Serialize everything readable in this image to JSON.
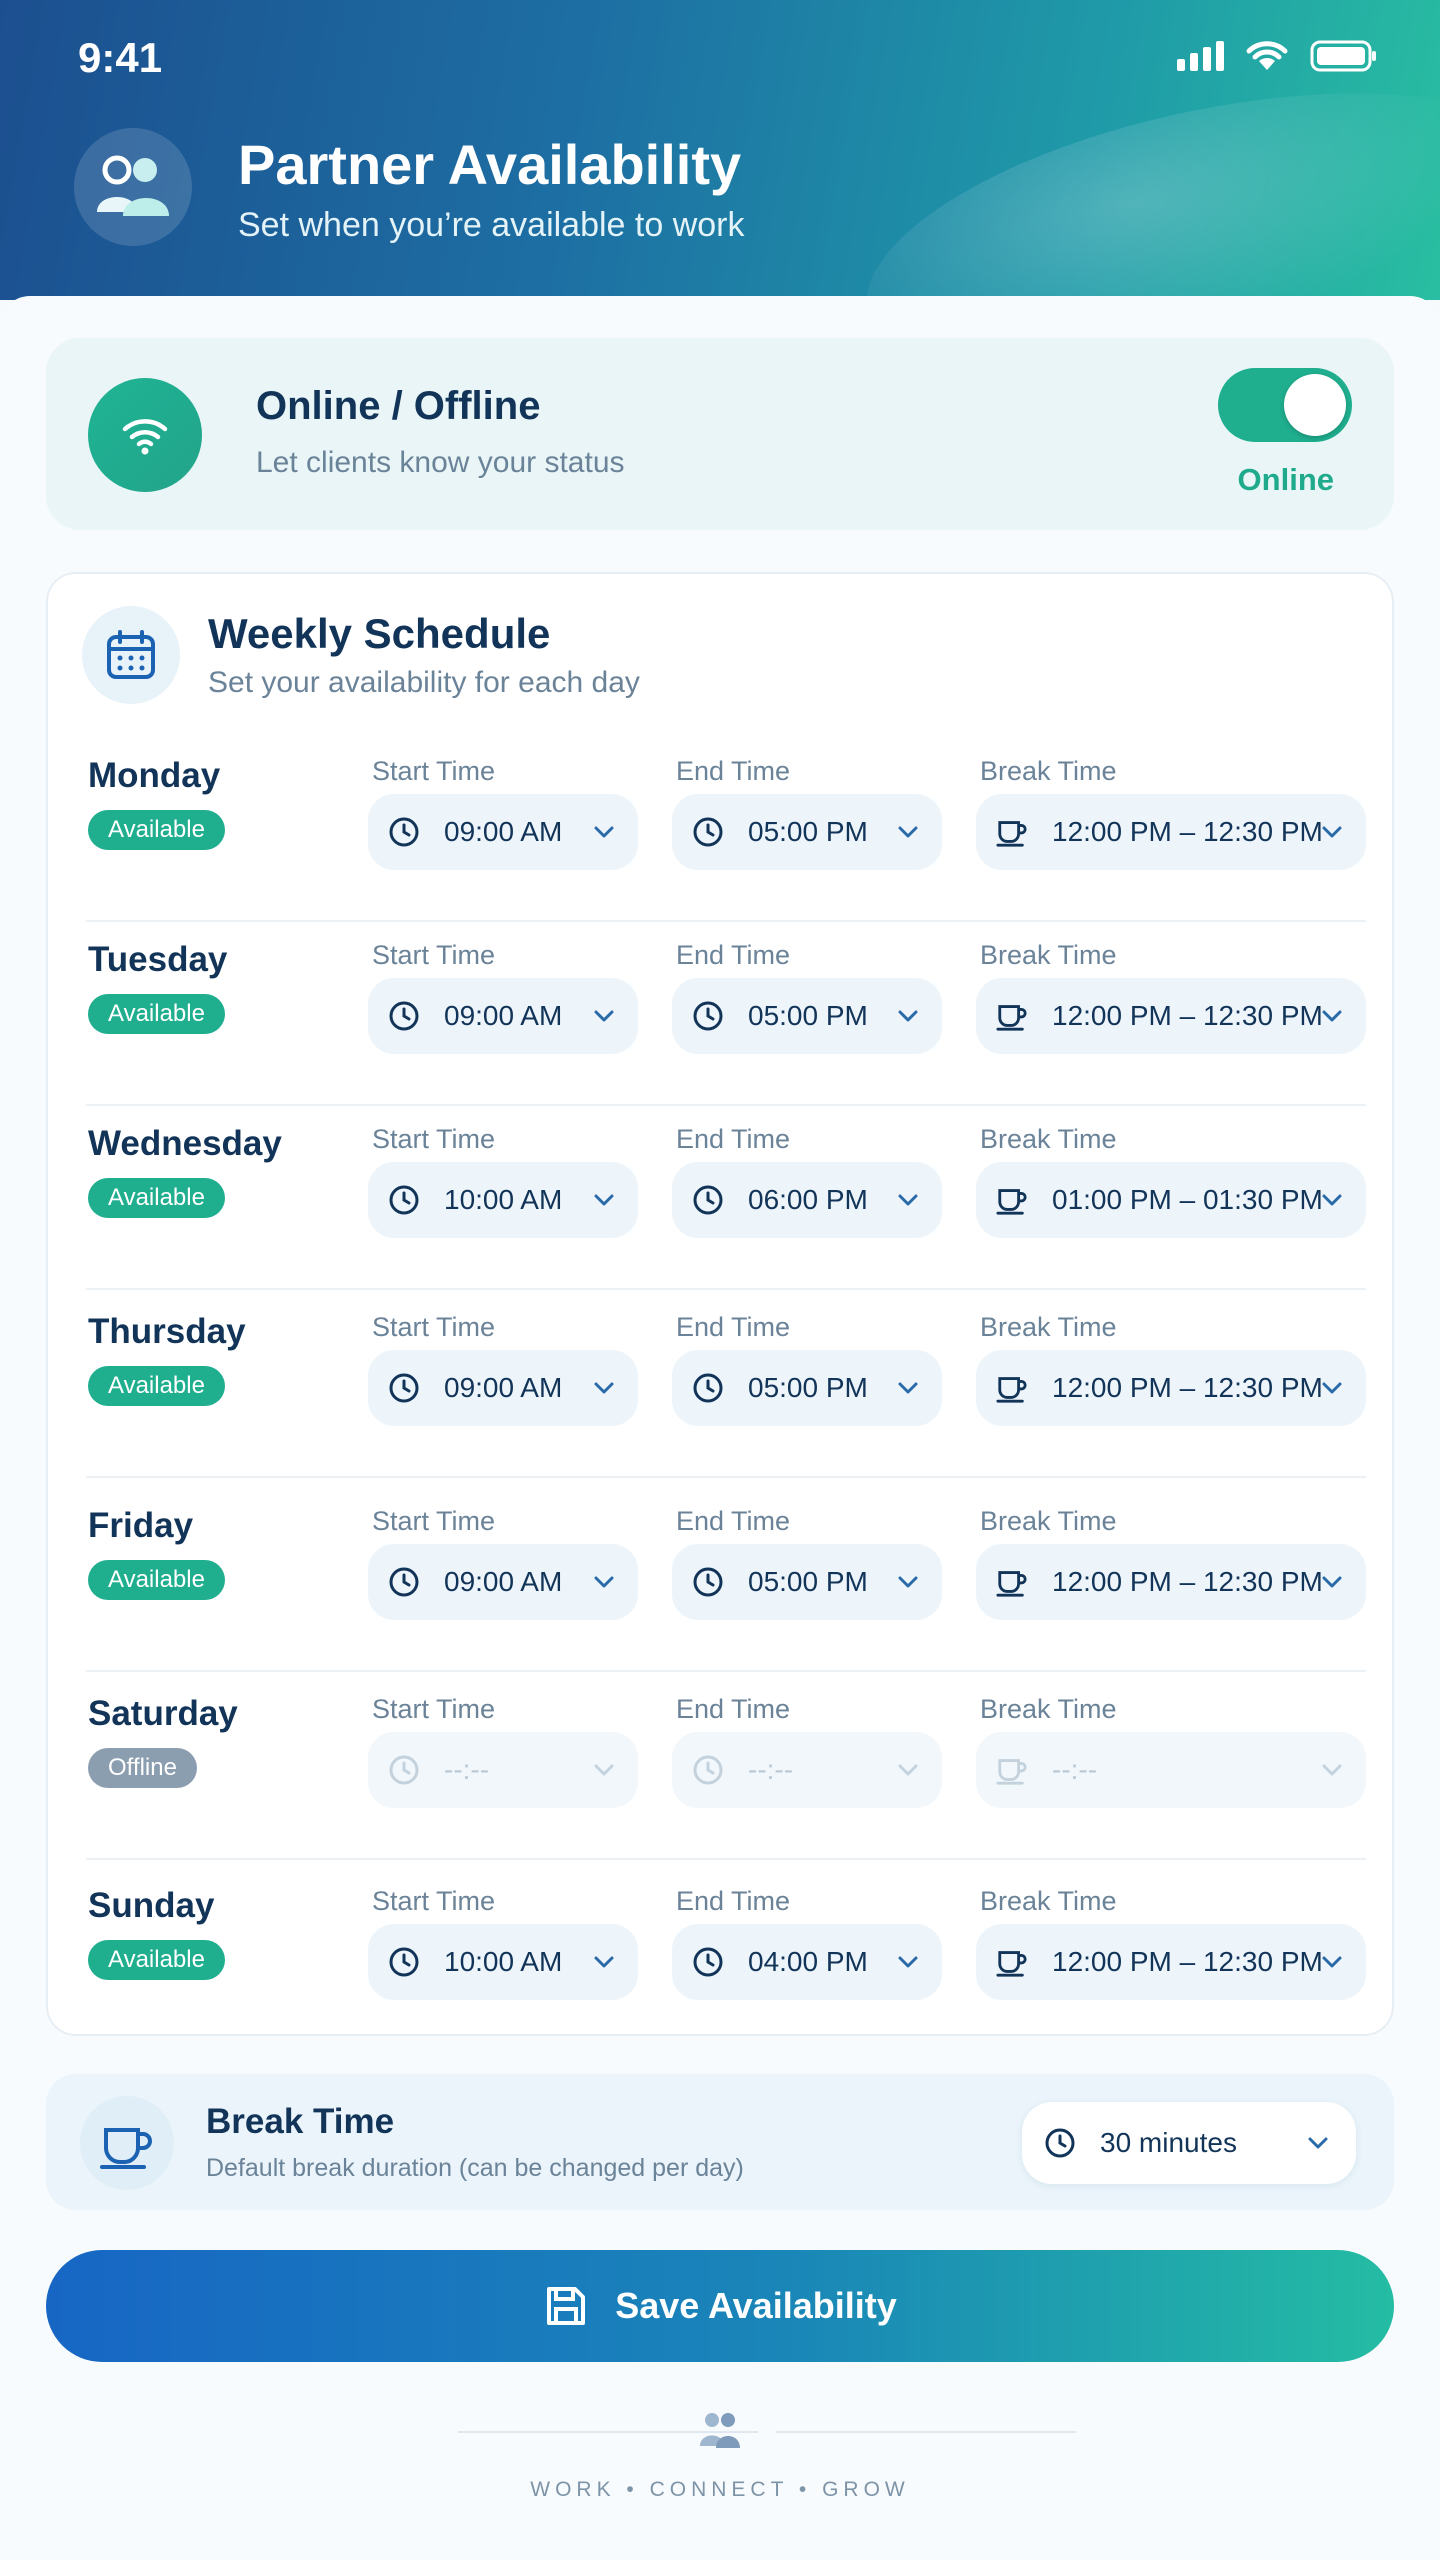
{
  "status_bar": {
    "time": "9:41"
  },
  "header": {
    "title": "Partner Availability",
    "subtitle": "Set when you’re available to work"
  },
  "online_card": {
    "title": "Online / Offline",
    "subtitle": "Let clients know your status",
    "toggle_on": true,
    "toggle_label": "Online"
  },
  "schedule": {
    "title": "Weekly Schedule",
    "subtitle": "Set your availability for each day",
    "labels": {
      "start": "Start Time",
      "end": "End Time",
      "break": "Break Time"
    },
    "days": [
      {
        "name": "Monday",
        "status": "Available",
        "start": "09:00 AM",
        "end": "05:00 PM",
        "break": "12:00 PM – 12:30 PM"
      },
      {
        "name": "Tuesday",
        "status": "Available",
        "start": "09:00 AM",
        "end": "05:00 PM",
        "break": "12:00 PM – 12:30 PM"
      },
      {
        "name": "Wednesday",
        "status": "Available",
        "start": "10:00 AM",
        "end": "06:00 PM",
        "break": "01:00 PM – 01:30 PM"
      },
      {
        "name": "Thursday",
        "status": "Available",
        "start": "09:00 AM",
        "end": "05:00 PM",
        "break": "12:00 PM – 12:30 PM"
      },
      {
        "name": "Friday",
        "status": "Available",
        "start": "09:00 AM",
        "end": "05:00 PM",
        "break": "12:00 PM – 12:30 PM"
      },
      {
        "name": "Saturday",
        "status": "Offline",
        "start": "--:--",
        "end": "--:--",
        "break": "--:--"
      },
      {
        "name": "Sunday",
        "status": "Available",
        "start": "10:00 AM",
        "end": "04:00 PM",
        "break": "12:00 PM – 12:30 PM"
      }
    ]
  },
  "break_card": {
    "title": "Break Time",
    "subtitle": "Default break duration (can be changed per day)",
    "value": "30 minutes"
  },
  "save_button": {
    "label": "Save Availability"
  },
  "footer": {
    "tagline": "WORK  •  CONNECT  •  GROW"
  },
  "colors": {
    "accent_green": "#1fae8e",
    "primary_blue": "#1766c4",
    "text_dark": "#123458",
    "text_muted": "#6b8398"
  },
  "icons": {
    "header": "partners-icon",
    "online": "wifi-icon",
    "schedule": "calendar-icon",
    "time": "clock-icon",
    "break": "coffee-icon",
    "save": "save-icon"
  }
}
